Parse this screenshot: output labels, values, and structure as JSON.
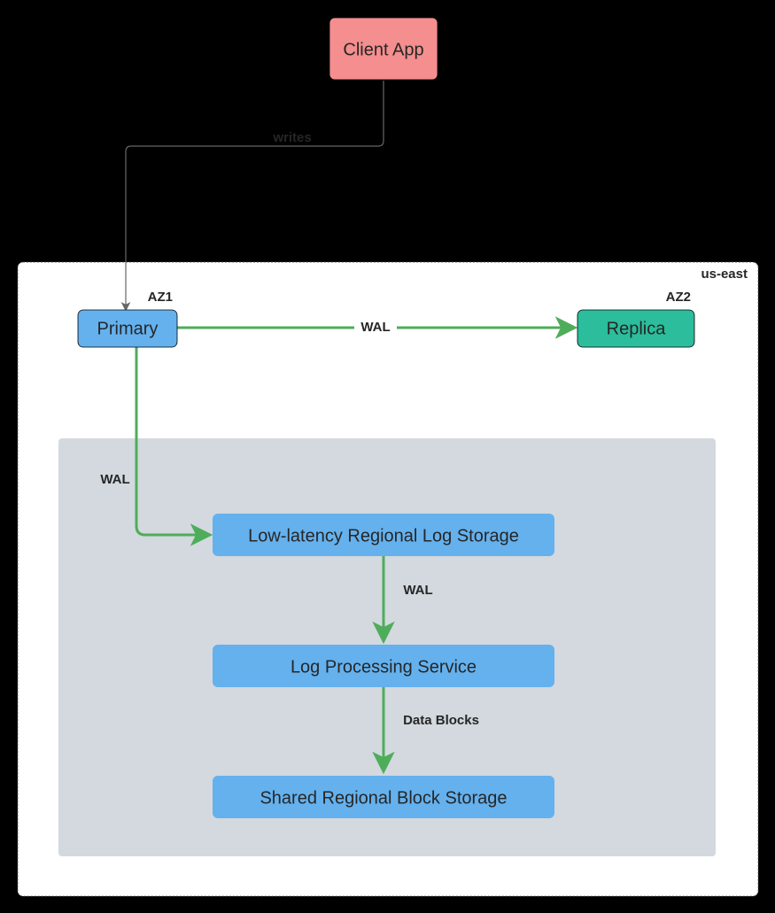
{
  "nodes": {
    "client": {
      "label": "Client App",
      "fill": "#f58e8e"
    },
    "primary": {
      "label": "Primary",
      "fill": "#64b1ee"
    },
    "replica": {
      "label": "Replica",
      "fill": "#2bbd9c"
    },
    "logstore": {
      "label": "Low-latency Regional Log Storage",
      "fill": "#64b1ee"
    },
    "logservice": {
      "label": "Log Processing Service",
      "fill": "#64b1ee"
    },
    "blockstore": {
      "label": "Shared Regional Block Storage",
      "fill": "#64b1ee"
    }
  },
  "groups": {
    "region": {
      "label": "us-east"
    },
    "az1": {
      "label": "AZ1"
    },
    "az2": {
      "label": "AZ2"
    }
  },
  "edges": {
    "client_primary": {
      "label": "writes"
    },
    "primary_replica": {
      "label": "WAL"
    },
    "primary_logstore": {
      "label": "WAL"
    },
    "logstore_logservice": {
      "label": "WAL"
    },
    "logservice_blockstore": {
      "label": "Data Blocks"
    }
  }
}
